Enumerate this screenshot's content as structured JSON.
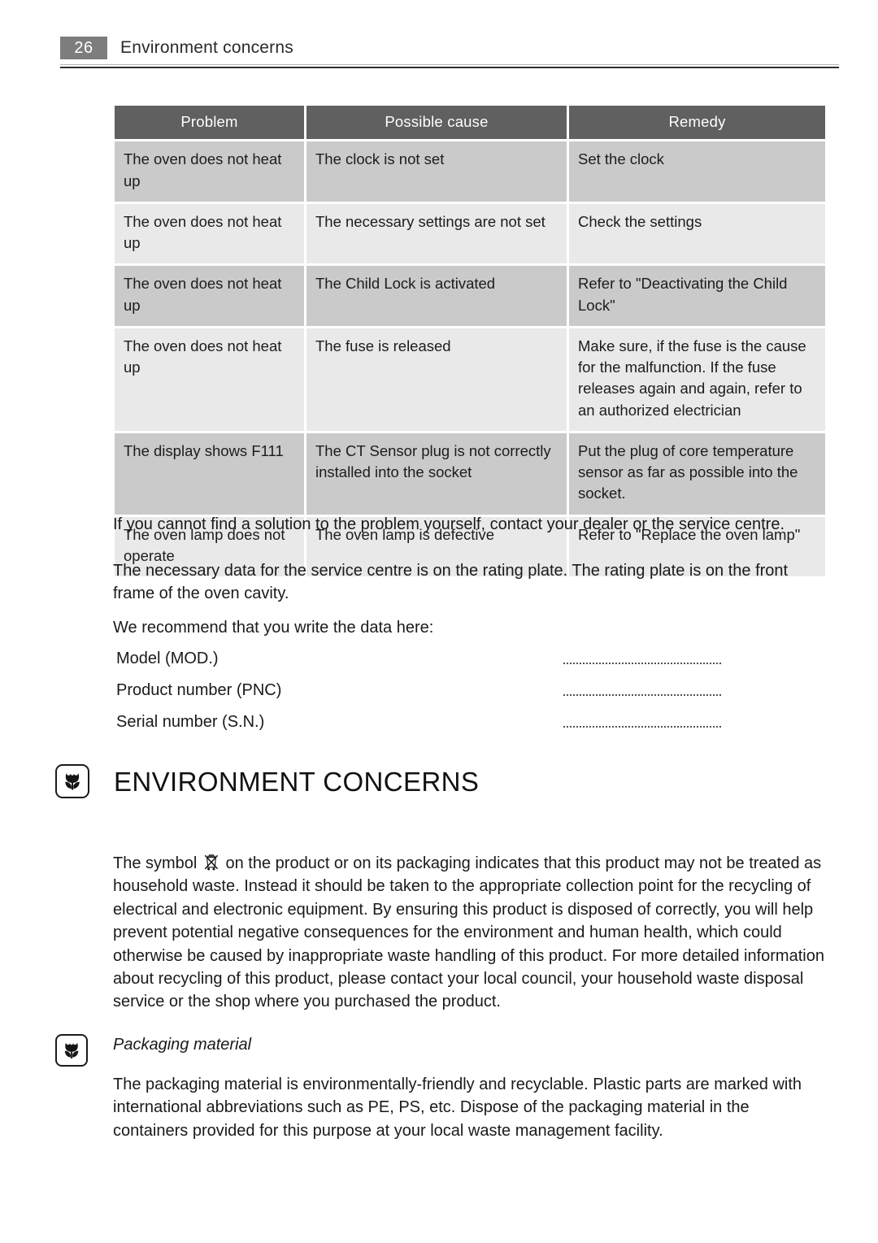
{
  "page_header": {
    "page_number": "26",
    "title": "Environment concerns"
  },
  "troubleshooting_table": {
    "columns": [
      "Problem",
      "Possible cause",
      "Remedy"
    ],
    "rows": [
      {
        "problem": "The oven does not heat up",
        "cause": "The clock is not set",
        "remedy": "Set the clock"
      },
      {
        "problem": "The oven does not heat up",
        "cause": "The necessary settings are not set",
        "remedy": "Check the settings"
      },
      {
        "problem": "The oven does not heat up",
        "cause": "The Child Lock is activated",
        "remedy": "Refer to \"Deactivating the Child Lock\""
      },
      {
        "problem": "The oven does not heat up",
        "cause": "The fuse is released",
        "remedy": "Make sure, if the fuse is the cause for the malfunction. If the fuse releases again and again, refer to an authorized electrician"
      },
      {
        "problem": "The display shows F111",
        "cause": "The CT Sensor plug is not correctly installed into the socket",
        "remedy": "Put the plug of core temperature sensor as far as possible into the socket."
      },
      {
        "problem": "The oven lamp does not operate",
        "cause": "The oven lamp is defective",
        "remedy": "Refer to \"Replace the oven lamp\""
      }
    ]
  },
  "service_info": {
    "paragraph_solution": "If you cannot find a solution to the problem yourself, contact your dealer or the service centre.",
    "paragraph_rating_plate": "The necessary data for the service centre is on the rating plate. The rating plate is on the front frame of the oven cavity.",
    "paragraph_write_data": "We recommend that you write the data here:",
    "fields": [
      {
        "label": "Model (MOD.)",
        "value": ""
      },
      {
        "label": "Product number (PNC)",
        "value": ""
      },
      {
        "label": "Serial number (S.N.)",
        "value": ""
      }
    ]
  },
  "environment_section": {
    "heading": "ENVIRONMENT CONCERNS",
    "icon": "tulip-icon",
    "weee_text_before": "The symbol",
    "weee_icon": "crossed-out-wheelie-bin-icon",
    "weee_text_after": "on the product or on its packaging indicates that this product may not be treated as household waste. Instead it should be taken to the appropriate collection point for the recycling of electrical and electronic equipment. By ensuring this product is disposed of correctly, you will help prevent potential negative consequences for the environment and human health, which could otherwise be caused by inappropriate waste handling of this product. For more detailed information about recycling of this product, please contact your local council, your household waste disposal service or the shop where you purchased the product."
  },
  "packaging_section": {
    "icon": "tulip-icon",
    "heading": "Packaging material",
    "paragraph": "The packaging material is environmentally-friendly and recyclable. Plastic parts are marked with international abbreviations such as PE, PS, etc. Dispose of the packaging material in the containers provided for this purpose at your local waste management facility."
  },
  "colors": {
    "page_number_bg": "#7d7d7d",
    "table_header_bg": "#606060",
    "row_dark_bg": "#cacaca",
    "row_light_bg": "#e9e9e9",
    "text": "#1a1a1a",
    "rule": "#2e2e2e"
  }
}
